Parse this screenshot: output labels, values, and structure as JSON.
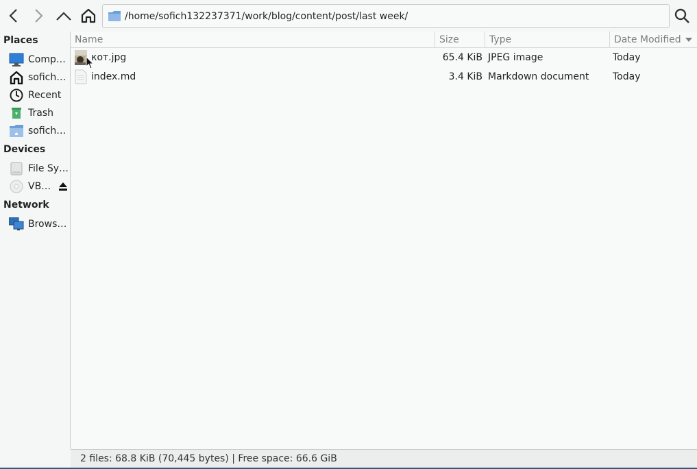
{
  "toolbar": {
    "back_icon": "chevron-left-icon",
    "forward_icon": "chevron-right-icon",
    "up_icon": "chevron-up-icon",
    "home_icon": "home-icon",
    "search_icon": "search-icon",
    "path": "/home/sofich132237371/work/blog/content/post/last week/"
  },
  "sidebar": {
    "places_header": "Places",
    "places": [
      {
        "label": "Comp…",
        "icon": "computer-icon"
      },
      {
        "label": "sofich…",
        "icon": "home-icon"
      },
      {
        "label": "Recent",
        "icon": "clock-icon"
      },
      {
        "label": "Trash",
        "icon": "trash-icon"
      },
      {
        "label": "sofich…",
        "icon": "folder-icon"
      }
    ],
    "devices_header": "Devices",
    "devices": [
      {
        "label": "File Sy…",
        "icon": "drive-icon"
      },
      {
        "label": "VB…",
        "icon": "disc-icon"
      }
    ],
    "network_header": "Network",
    "network": [
      {
        "label": "Brows…",
        "icon": "network-icon"
      }
    ]
  },
  "columns": {
    "name": "Name",
    "size": "Size",
    "type": "Type",
    "date": "Date Modified"
  },
  "files": [
    {
      "name": "кот.jpg",
      "size": "65.4 KiB",
      "type": "JPEG image",
      "date": "Today",
      "icon": "image-thumbnail-icon"
    },
    {
      "name": "index.md",
      "size": "3.4 KiB",
      "type": "Markdown document",
      "date": "Today",
      "icon": "text-document-icon"
    }
  ],
  "status": "2 files: 68.8 KiB (70,445 bytes) | Free space: 66.6 GiB",
  "colors": {
    "accent": "#2d5a87",
    "folder_blue": "#6a9fd8"
  }
}
